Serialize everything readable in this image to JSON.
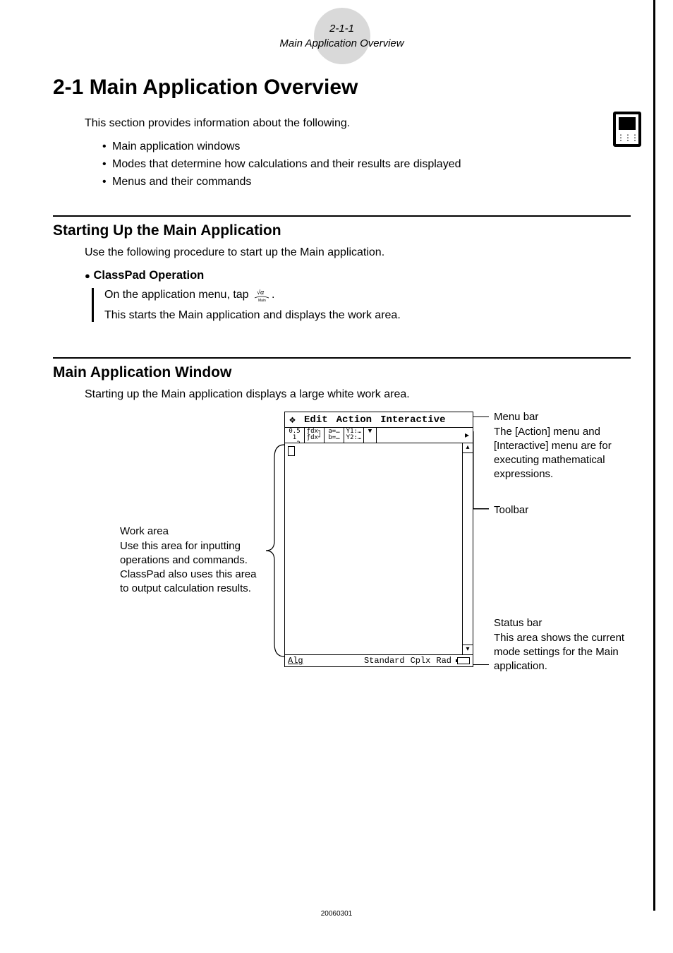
{
  "header": {
    "page_ref": "2-1-1",
    "page_title": "Main Application Overview"
  },
  "h1": "2-1 Main Application Overview",
  "intro": "This section provides information about the following.",
  "bullets": [
    "Main application windows",
    "Modes that determine how calculations and their results are displayed",
    "Menus and their commands"
  ],
  "section1": {
    "heading": "Starting Up the Main Application",
    "body": "Use the following procedure to start up the Main application.",
    "sub_head": "ClassPad Operation",
    "line1_a": "On the application menu, tap ",
    "line1_b": ".",
    "line2": "This starts the Main application and displays the work area."
  },
  "section2": {
    "heading": "Main Application Window",
    "body": "Starting up the Main application displays a large white work area."
  },
  "calc": {
    "menu": {
      "logo": "❖",
      "m1": "Edit",
      "m2": "Action",
      "m3": "Interactive"
    },
    "toolbar": {
      "b1": "0.5 1\n←►2",
      "b2": "ƒdx┐\nƒdx┘",
      "b3": "a=…\nb=…",
      "b4": "Y1:…\nY2:…",
      "b5": "▼",
      "arrow": "▸"
    },
    "scroll": {
      "up": "▴",
      "down": "▾"
    },
    "status": {
      "s1": "Alg",
      "s2": "Standard",
      "s3": "Cplx",
      "s4": "Rad"
    }
  },
  "callouts": {
    "left": {
      "title": "Work area",
      "body": "Use this area for inputting operations and commands. ClassPad also uses this area to output calculation results."
    },
    "r1": {
      "title": "Menu bar",
      "body": "The [Action] menu and [Interactive] menu are for executing mathematical expressions."
    },
    "r2": {
      "title": "Toolbar"
    },
    "r3": {
      "title": "Status bar",
      "body": "This area shows the current mode settings for the Main application."
    }
  },
  "footer": "20060301"
}
